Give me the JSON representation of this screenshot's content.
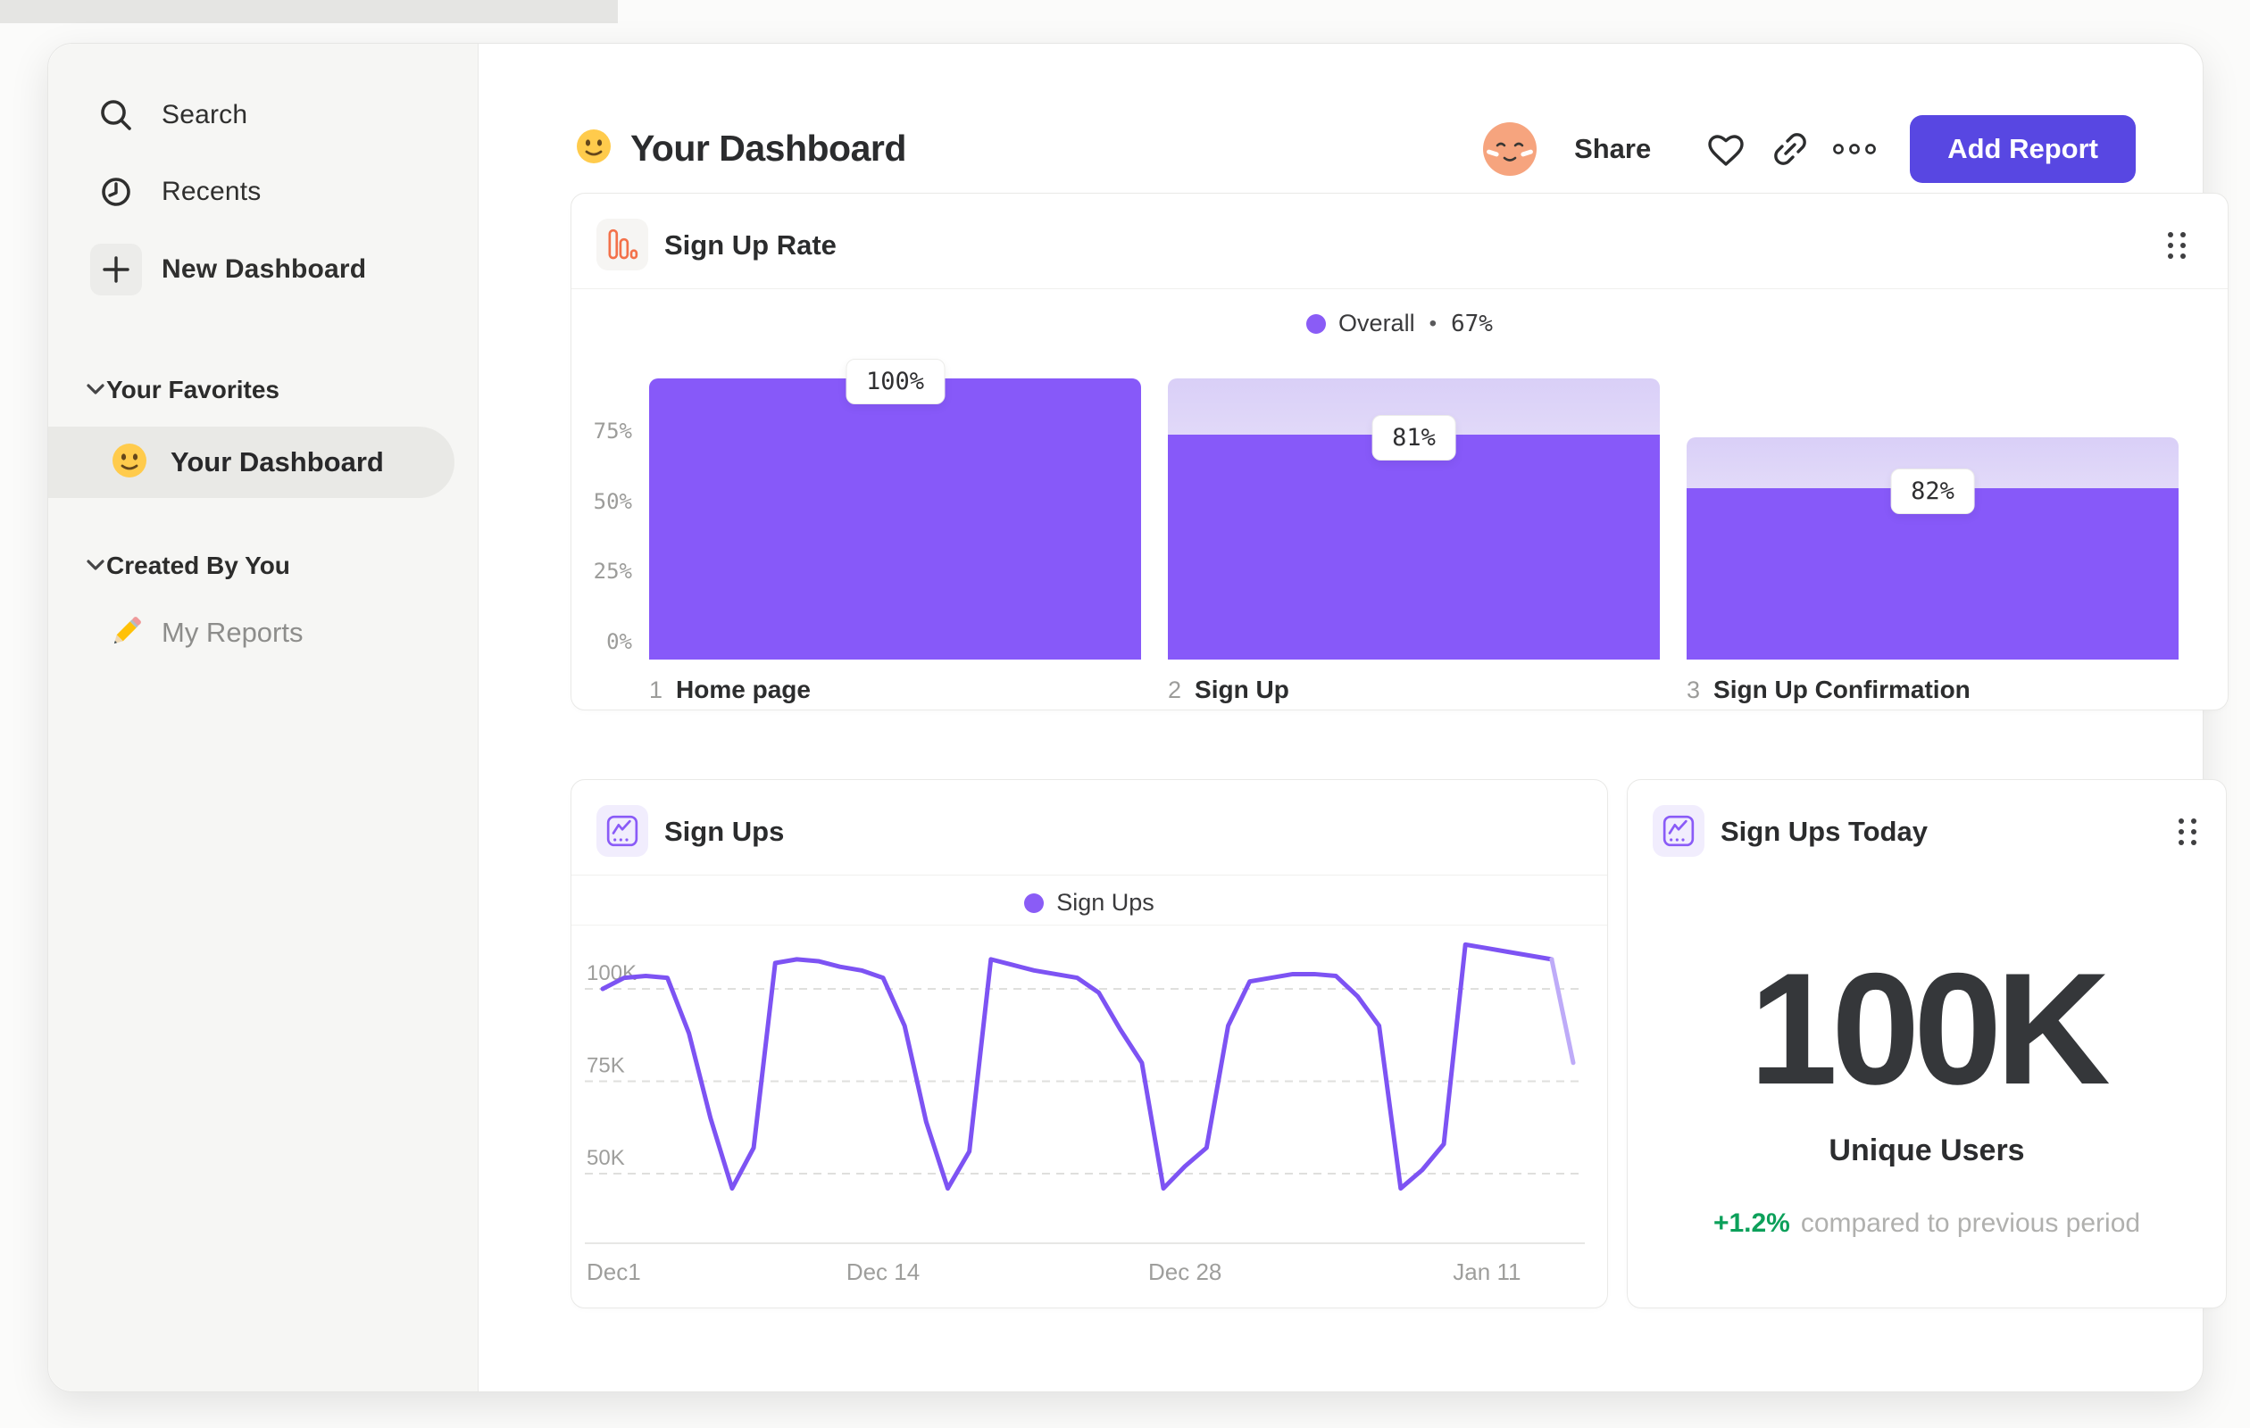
{
  "sidebar": {
    "nav": [
      {
        "id": "search",
        "label": "Search"
      },
      {
        "id": "recents",
        "label": "Recents"
      },
      {
        "id": "new-dashboard",
        "label": "New Dashboard"
      }
    ],
    "sections": [
      {
        "title": "Your Favorites",
        "items": [
          {
            "label": "Your Dashboard",
            "emoji": "slightly-smiling-face",
            "selected": true
          }
        ]
      },
      {
        "title": "Created By You",
        "items": [
          {
            "label": "My Reports",
            "emoji": "pencil",
            "selected": false
          }
        ]
      }
    ]
  },
  "header": {
    "emoji": "slightly-smiling-face",
    "title": "Your Dashboard",
    "share_label": "Share",
    "add_report_label": "Add Report"
  },
  "colors": {
    "bar_purple": "#8759F9",
    "line_purple": "#7D53F3",
    "line_faded": "#BEABF8",
    "legend_dot": "#8A5CF6",
    "button_purple": "#5847E2",
    "icon_orange": "#F3714A",
    "icon_purple": "#8A5BF7",
    "positive_green": "#0CA05A"
  },
  "chart_data": [
    {
      "type": "bar",
      "variant": "funnel",
      "title": "Sign Up Rate",
      "legend": {
        "label": "Overall",
        "separator": "•",
        "value": "67%"
      },
      "legend_position": "top-center",
      "categories": [
        "Home page",
        "Sign Up",
        "Sign Up Confirmation"
      ],
      "step_numbers": [
        "1",
        "2",
        "3"
      ],
      "values": [
        100,
        81,
        82
      ],
      "value_labels": [
        "100%",
        "81%",
        "82%"
      ],
      "cumulative_total_pct": [
        100,
        100,
        79
      ],
      "cumulative_solid_pct": [
        100,
        80,
        61
      ],
      "y_ticks": [
        {
          "label": "75%",
          "value": 75
        },
        {
          "label": "50%",
          "value": 50
        },
        {
          "label": "25%",
          "value": 25
        },
        {
          "label": "0%",
          "value": 0
        }
      ],
      "ylim": [
        0,
        100
      ],
      "grid": false
    },
    {
      "type": "line",
      "title": "Sign Ups",
      "legend": {
        "label": "Sign Ups"
      },
      "legend_position": "top-center",
      "x_ticks": [
        {
          "label": "Dec1",
          "day": 0
        },
        {
          "label": "Dec 14",
          "day": 13
        },
        {
          "label": "Dec 28",
          "day": 27
        },
        {
          "label": "Jan 11",
          "day": 41
        }
      ],
      "y_ticks": [
        {
          "label": "100K",
          "value": 100
        },
        {
          "label": "75K",
          "value": 75
        },
        {
          "label": "50K",
          "value": 50
        }
      ],
      "unit": "K",
      "values": [
        100,
        103,
        103.5,
        103,
        88,
        65,
        46,
        57,
        107,
        108,
        107.5,
        106,
        105,
        103,
        90,
        64,
        46,
        56,
        108,
        106.5,
        105,
        104,
        103,
        99,
        89,
        80,
        46,
        52,
        57,
        90,
        102,
        103,
        104,
        104,
        103.5,
        98,
        90,
        46,
        51,
        58,
        112,
        111,
        110,
        109,
        108,
        80
      ],
      "faded_tail_points": 2,
      "ylim": [
        30,
        115
      ],
      "grid": "dashed-horizontal"
    },
    {
      "type": "metric",
      "title": "Sign Ups Today",
      "value": "100K",
      "label": "Unique Users",
      "delta": "+1.2%",
      "delta_direction": "up",
      "comparison": "compared to previous period"
    }
  ]
}
